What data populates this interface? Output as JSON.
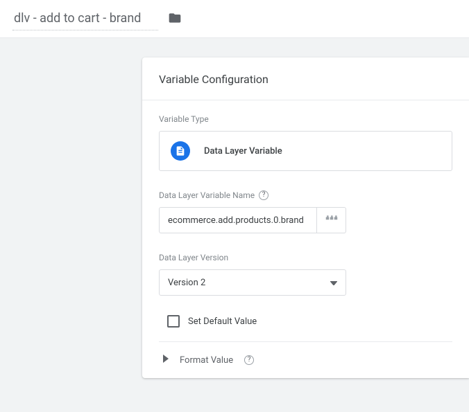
{
  "header": {
    "title": "dlv - add to cart - brand"
  },
  "card": {
    "heading": "Variable Configuration",
    "type_section_label": "Variable Type",
    "type_name": "Data Layer Variable",
    "name_label": "Data Layer Variable Name",
    "name_value": "ecommerce.add.products.0.brand",
    "version_label": "Data Layer Version",
    "version_value": "Version 2",
    "default_checkbox_label": "Set Default Value",
    "format_label": "Format Value"
  }
}
